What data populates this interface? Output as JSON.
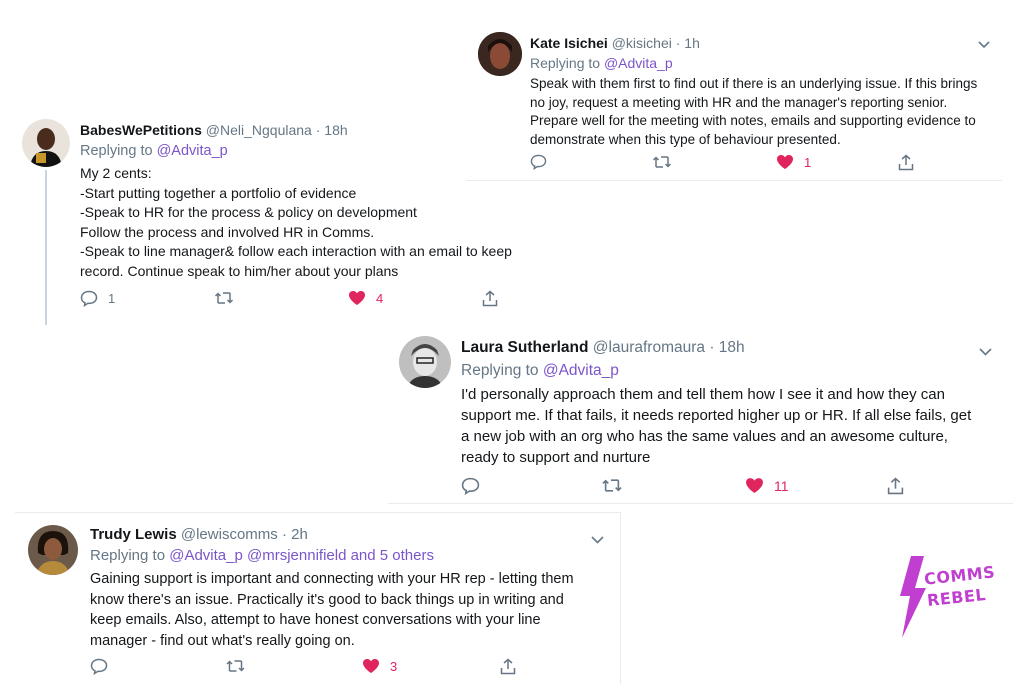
{
  "tweets": [
    {
      "name": "Kate Isichei",
      "handle": "@kisichei",
      "time": "· 1h",
      "replying_prefix": "Replying to",
      "replying_to": "@Advita_p",
      "lines": [
        "Speak with them first to find out if there is an underlying issue.  If this brings",
        "no joy, request a meeting with HR and the manager's reporting senior.",
        "Prepare well for the meeting with notes, emails and supporting evidence to",
        "demonstrate when this type of behaviour presented."
      ],
      "likes": "1"
    },
    {
      "name": "BabesWePetitions",
      "handle": "@Neli_Ngqulana",
      "time": "· 18h",
      "replying_prefix": "Replying to",
      "replying_to": "@Advita_p",
      "lines": [
        "My 2 cents:",
        "-Start putting together a portfolio of evidence",
        "-Speak to HR for the process & policy on development",
        "Follow the process and involved HR in Comms.",
        "-Speak to line manager& follow each interaction with an email to keep",
        "record. Continue speak to him/her about your plans"
      ],
      "replies": "1",
      "likes": "4"
    },
    {
      "name": "Laura Sutherland",
      "handle": "@laurafromaura",
      "time": "· 18h",
      "replying_prefix": "Replying to",
      "replying_to": "@Advita_p",
      "lines": [
        "I'd personally approach them and tell them how I see it and how they can",
        "support me. If that fails, it needs reported higher up or HR. If all else fails, get",
        "a new job with an org who has the same values and an awesome culture,",
        "ready to support and nurture"
      ],
      "likes": "11"
    },
    {
      "name": "Trudy Lewis",
      "handle": "@lewiscomms",
      "time": "· 2h",
      "replying_prefix": "Replying to",
      "replying_to": "@Advita_p @mrsjennifield and 5 others",
      "lines": [
        "Gaining support is important and connecting with your HR rep - letting them",
        "know there's an issue. Practically it's good to back things up in writing and",
        "keep emails. Also, attempt to have honest conversations with your line",
        "manager - find out what's really going on."
      ],
      "likes": "3"
    }
  ],
  "logo": {
    "line1": "COMMS",
    "line2": "REBEL",
    "color": "#c13fd0"
  },
  "colors": {
    "link": "#7b55c9",
    "like": "#e0245e",
    "muted": "#657786"
  }
}
